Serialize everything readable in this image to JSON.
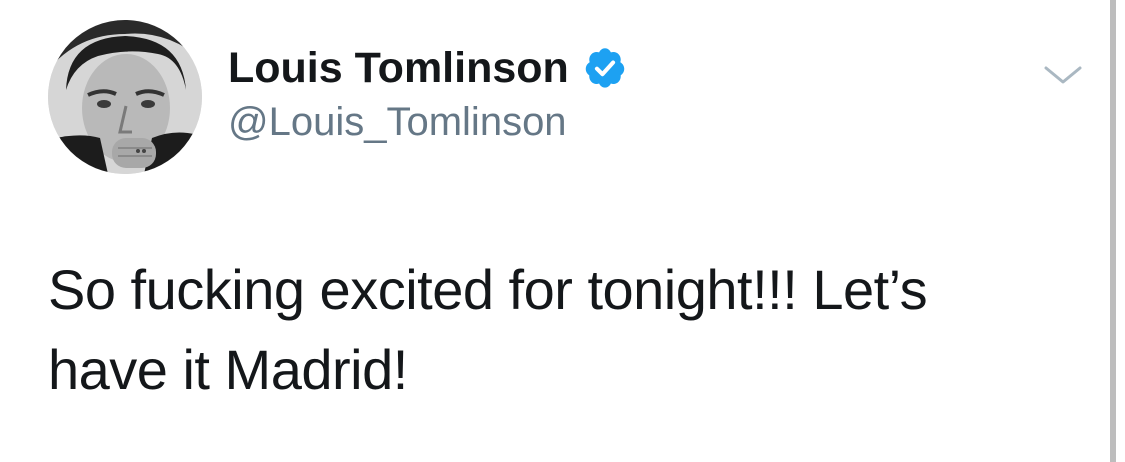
{
  "user": {
    "display_name": "Louis Tomlinson",
    "handle": "@Louis_Tomlinson",
    "verified": true,
    "avatar_icon": "profile-photo"
  },
  "tweet": {
    "text_lines": [
      "So fucking excited for tonight!!! Let’s",
      "have it Madrid!"
    ]
  },
  "icons": {
    "verified": "verified-badge-icon",
    "menu": "chevron-down-icon"
  },
  "colors": {
    "name": "#14171a",
    "handle": "#657786",
    "verified_badge": "#1da1f2",
    "caret": "#aab8c2"
  }
}
